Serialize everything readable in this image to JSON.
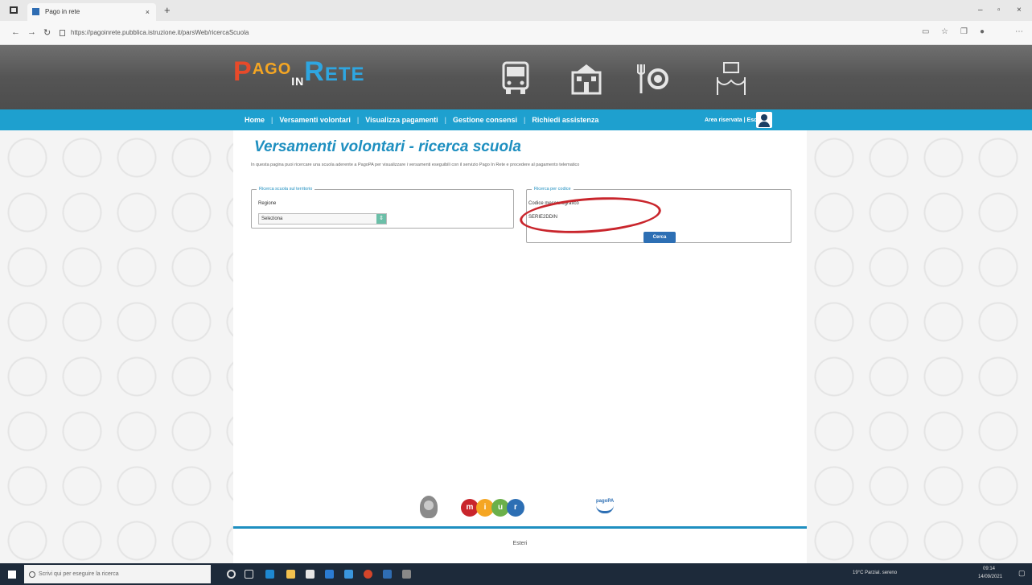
{
  "browser": {
    "tab_title": "Pago in rete",
    "tab_close": "×",
    "new_tab": "+",
    "url": "https://pagoinrete.pubblica.istruzione.it/parsWeb/ricercaScuola",
    "window_controls": [
      "–",
      "▫",
      "×"
    ]
  },
  "logo": {
    "p": "P",
    "ago": "AGO",
    "in": "IN",
    "r": "R",
    "ete": "ETE"
  },
  "nav": {
    "items": [
      "Home",
      "Versamenti volontari",
      "Visualizza pagamenti",
      "Gestione consensi",
      "Richiedi assistenza"
    ],
    "area_riservata": "Area riservata | Esci"
  },
  "main": {
    "title": "Versamenti volontari - ricerca scuola",
    "description": "In questa pagina puoi ricercare una scuola aderente a PagoPA per visualizzare i versamenti eseguibili con il servizio Pago In Rete e procedere al pagamento telematico",
    "territorial_search": {
      "legend": "Ricerca scuola sul territorio",
      "region_label": "Regione",
      "region_value": "Seleziona",
      "select_arrow": "⇕"
    },
    "code_search": {
      "legend": "Ricerca per codice",
      "code_label": "Codice meccanografico",
      "code_value": "SERIE2DDIN",
      "button_label": "Cerca"
    },
    "footer": "Esteri"
  },
  "footer_logos": {
    "miur_letters": [
      "m",
      "i",
      "u",
      "r"
    ],
    "pagopa_label": "pagoPA"
  },
  "taskbar": {
    "search_placeholder": "Scrivi qui per eseguire la ricerca",
    "tray_text": "19°C Parzial. sereno",
    "time": "09:14",
    "date": "14/09/2021"
  },
  "colors": {
    "nav_blue": "#1ea0cf",
    "title_blue": "#1e8fc0",
    "button_blue": "#2d6fb4",
    "highlight_red": "#c9252c"
  }
}
